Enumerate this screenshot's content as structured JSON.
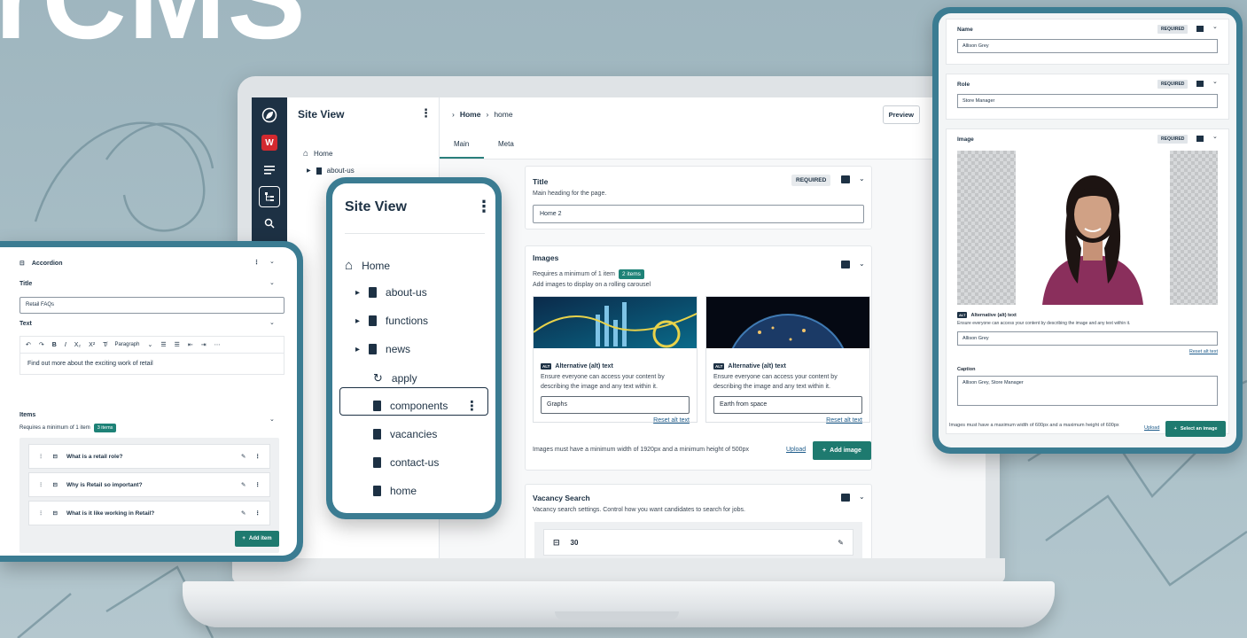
{
  "hero": {
    "title": "rCMS"
  },
  "laptop": {
    "tree_panel": {
      "title": "Site View",
      "items": [
        {
          "label": "Home",
          "type": "home"
        },
        {
          "label": "about-us",
          "type": "page"
        }
      ]
    },
    "rail": {
      "badge_letter": "W"
    },
    "breadcrumb": {
      "first": "Home",
      "second": "home"
    },
    "preview_label": "Preview",
    "tabs": [
      {
        "label": "Main"
      },
      {
        "label": "Meta"
      }
    ],
    "title_card": {
      "heading": "Title",
      "description": "Main heading for the page.",
      "required_label": "REQUIRED",
      "value": "Home 2"
    },
    "images_card": {
      "heading": "Images",
      "requirement": "Requires a minimum of 1 item",
      "count_badge": "2 items",
      "description": "Add images to display on a rolling carousel",
      "tiles": [
        {
          "alt_badge": "ALT",
          "alt_title": "Alternative (alt) text",
          "alt_desc": "Ensure everyone can access your content by describing the image and any text within it.",
          "alt_value": "Graphs",
          "reset": "Reset alt text"
        },
        {
          "alt_badge": "ALT",
          "alt_title": "Alternative (alt) text",
          "alt_desc": "Ensure everyone can access your content by describing the image and any text within it.",
          "alt_value": "Earth from space",
          "reset": "Reset alt text"
        }
      ],
      "footer_note": "Images must have a minimum width of 1920px and a minimum height of 500px",
      "upload_label": "Upload",
      "add_image_label": "Add image"
    },
    "vacancy_card": {
      "heading": "Vacancy Search",
      "description": "Vacancy search settings. Control how you want candidates to search for jobs.",
      "item_value": "30"
    }
  },
  "phone": {
    "title": "Site View",
    "items": [
      {
        "label": "Home",
        "type": "home",
        "expand": false
      },
      {
        "label": "about-us",
        "type": "page",
        "expand": true
      },
      {
        "label": "functions",
        "type": "page",
        "expand": true
      },
      {
        "label": "news",
        "type": "page",
        "expand": true
      },
      {
        "label": "apply",
        "type": "apply",
        "expand": false
      },
      {
        "label": "components",
        "type": "page",
        "expand": false,
        "selected": true
      },
      {
        "label": "vacancies",
        "type": "page",
        "expand": false
      },
      {
        "label": "contact-us",
        "type": "page",
        "expand": false
      },
      {
        "label": "home",
        "type": "page",
        "expand": false
      }
    ]
  },
  "accordion": {
    "header": "Accordion",
    "title_label": "Title",
    "title_value": "Retail FAQs",
    "text_label": "Text",
    "toolbar": {
      "paragraph": "Paragraph"
    },
    "editor_text": "Find out more about the exciting work of retail",
    "items_label": "Items",
    "items_requirement": "Requires a minimum of 1 item",
    "items_badge": "3 items",
    "items": [
      {
        "label": "What is a retail role?"
      },
      {
        "label": "Why is Retail so important?"
      },
      {
        "label": "What is it like working in Retail?"
      }
    ],
    "add_item_label": "Add item"
  },
  "profile": {
    "name_label": "Name",
    "name_value": "Allison Grey",
    "role_label": "Role",
    "role_value": "Store Manager",
    "image_label": "Image",
    "required_label": "REQUIRED",
    "alt_badge": "ALT",
    "alt_title": "Alternative (alt) text",
    "alt_desc": "Ensure everyone can access your content by describing the image and any text within it.",
    "alt_value": "Allison Grey",
    "reset": "Reset alt text",
    "caption_label": "Caption",
    "caption_value": "Allison Grey, Store Manager",
    "footer_note": "Images must have a maximum width of 600px and a maximum height of 600px",
    "upload_label": "Upload",
    "select_label": "Select an image"
  },
  "colors": {
    "accent": "#1e7a6f",
    "navy": "#1d3144",
    "frame": "#3b7c92"
  }
}
